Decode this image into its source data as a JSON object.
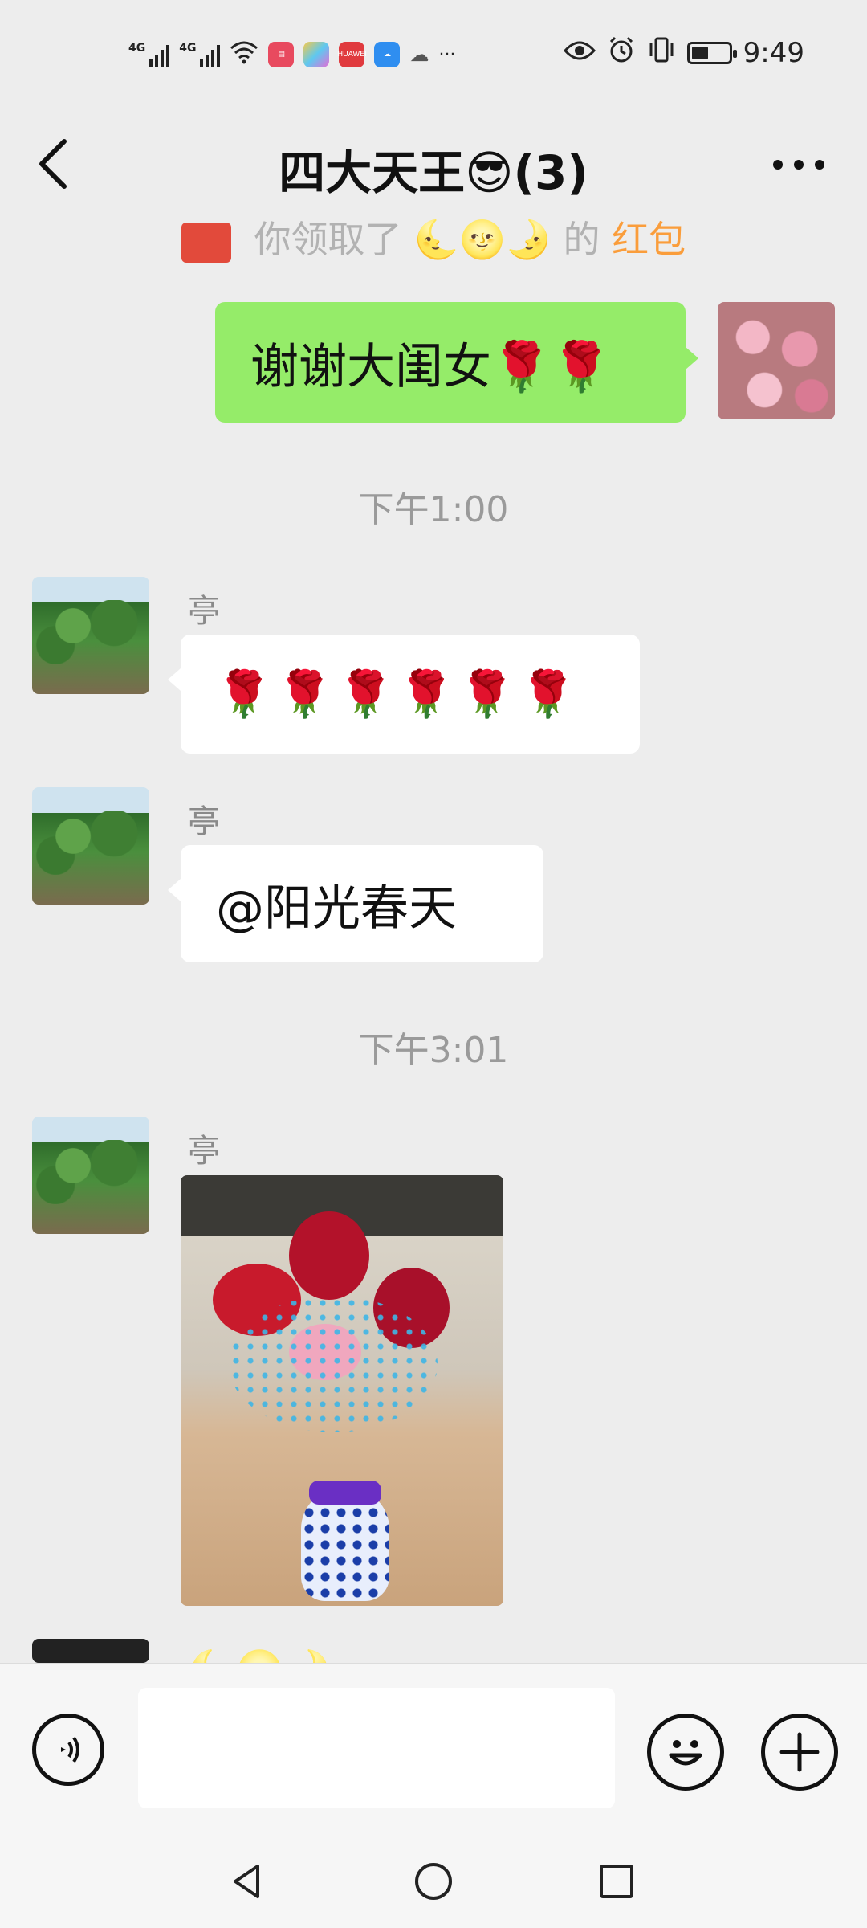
{
  "status_bar": {
    "network_1": "4G",
    "network_2": "4G",
    "app_icons": [
      "book-app-icon",
      "theme-app-icon",
      "huawei-appgallery-icon",
      "cloud-app-icon",
      "weather-icon"
    ],
    "huawei_label": "HUAWEI",
    "more": "···",
    "time": "9:49"
  },
  "header": {
    "title": "四大天王😎(3)"
  },
  "system_message": {
    "prefix": "你领取了",
    "sender_emoji": "🌜🌝🌛",
    "middle": "的",
    "link": "红包"
  },
  "messages": [
    {
      "type": "outgoing",
      "text": "谢谢大闺女🌹🌹"
    },
    {
      "type": "time",
      "text": "下午1:00"
    },
    {
      "type": "incoming",
      "sender": "亭",
      "text": "🌹🌹🌹🌹🌹🌹"
    },
    {
      "type": "incoming",
      "sender": "亭",
      "text": "@阳光春天"
    },
    {
      "type": "time",
      "text": "下午3:01"
    },
    {
      "type": "incoming",
      "sender": "亭",
      "image": "bouquet-in-vase-photo"
    },
    {
      "type": "incoming_partial",
      "text": "🌜🌝🌛"
    }
  ],
  "input_bar": {
    "voice_icon": "voice-icon",
    "placeholder": "",
    "emoji_icon": "emoji-icon",
    "plus_icon": "plus-icon"
  },
  "colors": {
    "outgoing_bubble": "#95ec69",
    "incoming_bubble": "#ffffff",
    "background": "#ededed",
    "red_packet": "#e24a3b",
    "red_packet_link": "#fa9d3b"
  }
}
